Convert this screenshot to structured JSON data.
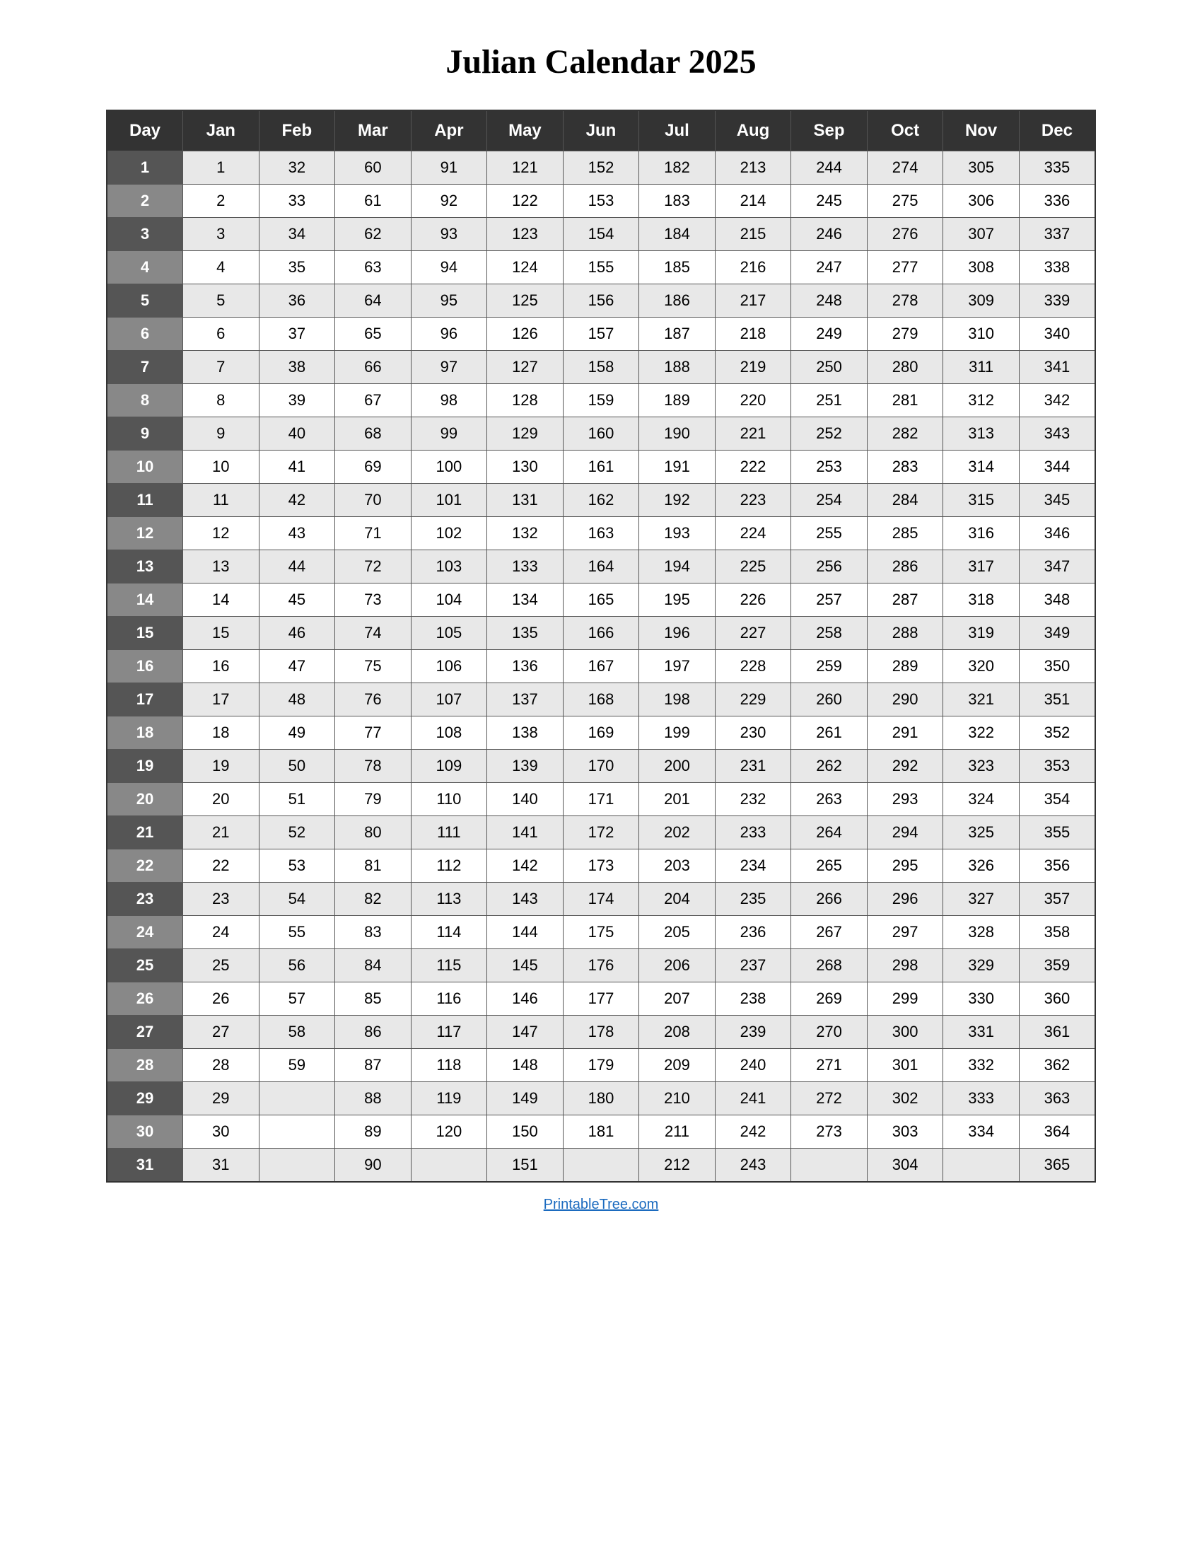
{
  "title": "Julian Calendar 2025",
  "headers": [
    "Day",
    "Jan",
    "Feb",
    "Mar",
    "Apr",
    "May",
    "Jun",
    "Jul",
    "Aug",
    "Sep",
    "Oct",
    "Nov",
    "Dec"
  ],
  "rows": [
    [
      1,
      1,
      32,
      60,
      91,
      121,
      152,
      182,
      213,
      244,
      274,
      305,
      335
    ],
    [
      2,
      2,
      33,
      61,
      92,
      122,
      153,
      183,
      214,
      245,
      275,
      306,
      336
    ],
    [
      3,
      3,
      34,
      62,
      93,
      123,
      154,
      184,
      215,
      246,
      276,
      307,
      337
    ],
    [
      4,
      4,
      35,
      63,
      94,
      124,
      155,
      185,
      216,
      247,
      277,
      308,
      338
    ],
    [
      5,
      5,
      36,
      64,
      95,
      125,
      156,
      186,
      217,
      248,
      278,
      309,
      339
    ],
    [
      6,
      6,
      37,
      65,
      96,
      126,
      157,
      187,
      218,
      249,
      279,
      310,
      340
    ],
    [
      7,
      7,
      38,
      66,
      97,
      127,
      158,
      188,
      219,
      250,
      280,
      311,
      341
    ],
    [
      8,
      8,
      39,
      67,
      98,
      128,
      159,
      189,
      220,
      251,
      281,
      312,
      342
    ],
    [
      9,
      9,
      40,
      68,
      99,
      129,
      160,
      190,
      221,
      252,
      282,
      313,
      343
    ],
    [
      10,
      10,
      41,
      69,
      100,
      130,
      161,
      191,
      222,
      253,
      283,
      314,
      344
    ],
    [
      11,
      11,
      42,
      70,
      101,
      131,
      162,
      192,
      223,
      254,
      284,
      315,
      345
    ],
    [
      12,
      12,
      43,
      71,
      102,
      132,
      163,
      193,
      224,
      255,
      285,
      316,
      346
    ],
    [
      13,
      13,
      44,
      72,
      103,
      133,
      164,
      194,
      225,
      256,
      286,
      317,
      347
    ],
    [
      14,
      14,
      45,
      73,
      104,
      134,
      165,
      195,
      226,
      257,
      287,
      318,
      348
    ],
    [
      15,
      15,
      46,
      74,
      105,
      135,
      166,
      196,
      227,
      258,
      288,
      319,
      349
    ],
    [
      16,
      16,
      47,
      75,
      106,
      136,
      167,
      197,
      228,
      259,
      289,
      320,
      350
    ],
    [
      17,
      17,
      48,
      76,
      107,
      137,
      168,
      198,
      229,
      260,
      290,
      321,
      351
    ],
    [
      18,
      18,
      49,
      77,
      108,
      138,
      169,
      199,
      230,
      261,
      291,
      322,
      352
    ],
    [
      19,
      19,
      50,
      78,
      109,
      139,
      170,
      200,
      231,
      262,
      292,
      323,
      353
    ],
    [
      20,
      20,
      51,
      79,
      110,
      140,
      171,
      201,
      232,
      263,
      293,
      324,
      354
    ],
    [
      21,
      21,
      52,
      80,
      111,
      141,
      172,
      202,
      233,
      264,
      294,
      325,
      355
    ],
    [
      22,
      22,
      53,
      81,
      112,
      142,
      173,
      203,
      234,
      265,
      295,
      326,
      356
    ],
    [
      23,
      23,
      54,
      82,
      113,
      143,
      174,
      204,
      235,
      266,
      296,
      327,
      357
    ],
    [
      24,
      24,
      55,
      83,
      114,
      144,
      175,
      205,
      236,
      267,
      297,
      328,
      358
    ],
    [
      25,
      25,
      56,
      84,
      115,
      145,
      176,
      206,
      237,
      268,
      298,
      329,
      359
    ],
    [
      26,
      26,
      57,
      85,
      116,
      146,
      177,
      207,
      238,
      269,
      299,
      330,
      360
    ],
    [
      27,
      27,
      58,
      86,
      117,
      147,
      178,
      208,
      239,
      270,
      300,
      331,
      361
    ],
    [
      28,
      28,
      59,
      87,
      118,
      148,
      179,
      209,
      240,
      271,
      301,
      332,
      362
    ],
    [
      29,
      29,
      "",
      88,
      119,
      149,
      180,
      210,
      241,
      272,
      302,
      333,
      363
    ],
    [
      30,
      30,
      "",
      89,
      120,
      150,
      181,
      211,
      242,
      273,
      303,
      334,
      364
    ],
    [
      31,
      31,
      "",
      90,
      "",
      151,
      "",
      212,
      243,
      "",
      304,
      "",
      365
    ]
  ],
  "footer": "PrintableTree.com"
}
